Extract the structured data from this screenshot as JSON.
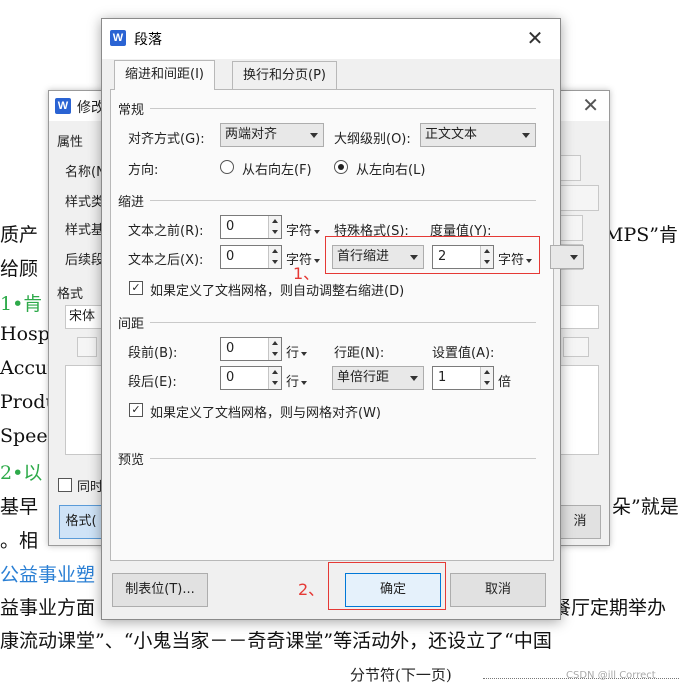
{
  "document": {
    "lines": [
      {
        "text": "质产",
        "cls": ""
      },
      {
        "text": "给顾",
        "cls": ""
      },
      {
        "text": "1•肯",
        "cls": "doc-green"
      },
      {
        "text": "Hospi",
        "cls": ""
      },
      {
        "text": "Accur",
        "cls": ""
      },
      {
        "text": "Produ",
        "cls": ""
      },
      {
        "text": "Speed",
        "cls": ""
      },
      {
        "text": "2•以",
        "cls": "doc-green"
      },
      {
        "text": "基早",
        "cls": ""
      },
      {
        "text": "。相",
        "cls": ""
      },
      {
        "text": "公益事业塑",
        "cls": "doc-blue"
      },
      {
        "text": "益事业方面",
        "cls": ""
      }
    ],
    "right_lines": [
      "MPS”肯",
      "朵”就是",
      "餐厅定期举办"
    ],
    "bottom_line": "康流动课堂”、“小鬼当家－－奇奇课堂”等活动外，还设立了“中国",
    "section_break": "分节符(下一页)",
    "watermark": "CSDN @ill Correct"
  },
  "back_dialog": {
    "title": "修改",
    "section": "属性",
    "labels": [
      "名称(N",
      "样式类",
      "样式基",
      "后续段"
    ],
    "format_section": "格式",
    "font": "宋体",
    "same_label": "同时",
    "format_button": "格式(",
    "cancel_button": "消"
  },
  "dialog": {
    "title": "段落",
    "icon_letter": "W",
    "tabs": [
      "缩进和间距(I)",
      "换行和分页(P)"
    ],
    "general": {
      "heading": "常规",
      "align_label": "对齐方式(G):",
      "align_value": "两端对齐",
      "outline_label": "大纲级别(O):",
      "outline_value": "正文文本",
      "direction_label": "方向:",
      "rtl_label": "从右向左(F)",
      "ltr_label": "从左向右(L)"
    },
    "indent": {
      "heading": "缩进",
      "before_label": "文本之前(R):",
      "before_value": "0",
      "before_unit": "字符",
      "after_label": "文本之后(X):",
      "after_value": "0",
      "after_unit": "字符",
      "special_label": "特殊格式(S):",
      "special_value": "首行缩进",
      "measure_label": "度量值(Y):",
      "measure_value": "2",
      "measure_unit": "字符",
      "grid_check": "如果定义了文档网格，则自动调整右缩进(D)"
    },
    "spacing": {
      "heading": "间距",
      "before_label": "段前(B):",
      "before_value": "0",
      "before_unit": "行",
      "after_label": "段后(E):",
      "after_value": "0",
      "after_unit": "行",
      "line_label": "行距(N):",
      "line_value": "单倍行距",
      "set_label": "设置值(A):",
      "set_value": "1",
      "set_unit": "倍",
      "grid_check": "如果定义了文档网格，则与网格对齐(W)"
    },
    "preview_heading": "预览",
    "tabs_button": "制表位(T)...",
    "ok_button": "确定",
    "cancel_button": "取消"
  },
  "annotations": {
    "step1": "1、",
    "step2": "2、"
  }
}
